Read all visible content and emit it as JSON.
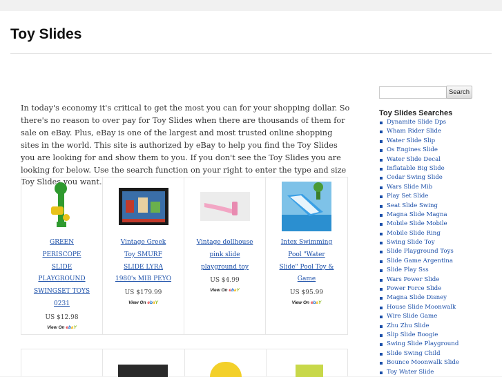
{
  "site": {
    "title": "Toy Slides"
  },
  "intro": "In today's economy it's critical to get the most you can for your shopping dollar. So there's no reason to over pay for Toy Slides when there are thousands of them for sale on eBay. Plus, eBay is one of the largest and most trusted online shopping sites in the world. This site is authorized by eBay to help you find the Toy Slides you are looking for and show them to you. If you don't see the Toy Slides you are looking for below. Use the search function on your right to enter the type and size Toy Slides you want.",
  "products": [
    {
      "title": "GREEN PERISCOPE SLIDE PLAYGROUND SWINGSET TOYS 0231",
      "price": "US $12.98",
      "view_on": "View On"
    },
    {
      "title": "Vintage Greek Toy SMURF SLIDE LYRA 1980's MIB PEYO",
      "price": "US $179.99",
      "view_on": "View On"
    },
    {
      "title": "Vintage dollhouse pink slide playground toy",
      "price": "US $4.99",
      "view_on": "View On"
    },
    {
      "title": "Intex Swimming Pool \"Water Slide\" Pool Toy & Game",
      "price": "US $95.99",
      "view_on": "View On"
    }
  ],
  "search": {
    "placeholder": "",
    "button_label": "Search"
  },
  "sidebar": {
    "heading": "Toy Slides Searches",
    "items": [
      "Dynamite Slide Dps",
      "Wham Rider Slide",
      "Water Slide Slip",
      "Os Engines Slide",
      "Water Slide Decal",
      "Inflatable Big Slide",
      "Cedar Swing Slide",
      "Wars Slide Mib",
      "Play Set Slide",
      "Seat Slide Swing",
      "Magna Slide Magna",
      "Mobile Slide Mobile",
      "Mobile Slide Ring",
      "Swing Slide Toy",
      "Slide Playground Toys",
      "Slide Game Argentina",
      "Slide Play Sss",
      "Wars Power Slide",
      "Power Force Slide",
      "Magna Slide Disney",
      "House Slide Moonwalk",
      "Wire Slide Game",
      "Zhu Zhu Slide",
      "Slip Slide Boogie",
      "Swing Slide Playground",
      "Slide Swing Child",
      "Bounce Moonwalk Slide",
      "Toy Water Slide"
    ]
  },
  "colors": {
    "link": "#1a4ea8",
    "background": "#f1f1f1",
    "page": "#ffffff"
  }
}
